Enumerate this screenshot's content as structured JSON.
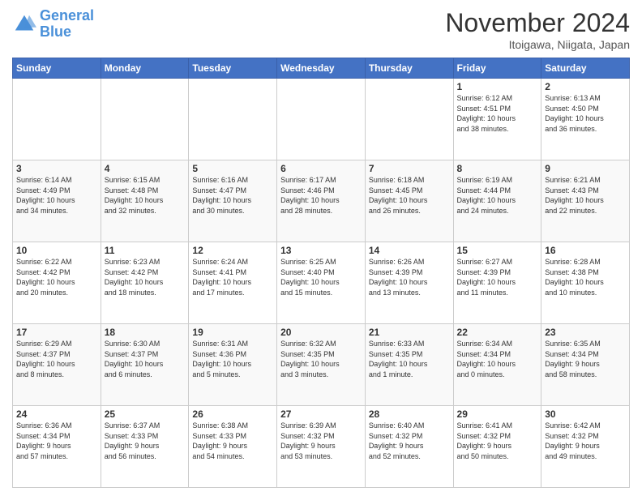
{
  "header": {
    "logo_line1": "General",
    "logo_line2": "Blue",
    "month": "November 2024",
    "location": "Itoigawa, Niigata, Japan"
  },
  "weekdays": [
    "Sunday",
    "Monday",
    "Tuesday",
    "Wednesday",
    "Thursday",
    "Friday",
    "Saturday"
  ],
  "weeks": [
    [
      {
        "day": "",
        "info": ""
      },
      {
        "day": "",
        "info": ""
      },
      {
        "day": "",
        "info": ""
      },
      {
        "day": "",
        "info": ""
      },
      {
        "day": "",
        "info": ""
      },
      {
        "day": "1",
        "info": "Sunrise: 6:12 AM\nSunset: 4:51 PM\nDaylight: 10 hours\nand 38 minutes."
      },
      {
        "day": "2",
        "info": "Sunrise: 6:13 AM\nSunset: 4:50 PM\nDaylight: 10 hours\nand 36 minutes."
      }
    ],
    [
      {
        "day": "3",
        "info": "Sunrise: 6:14 AM\nSunset: 4:49 PM\nDaylight: 10 hours\nand 34 minutes."
      },
      {
        "day": "4",
        "info": "Sunrise: 6:15 AM\nSunset: 4:48 PM\nDaylight: 10 hours\nand 32 minutes."
      },
      {
        "day": "5",
        "info": "Sunrise: 6:16 AM\nSunset: 4:47 PM\nDaylight: 10 hours\nand 30 minutes."
      },
      {
        "day": "6",
        "info": "Sunrise: 6:17 AM\nSunset: 4:46 PM\nDaylight: 10 hours\nand 28 minutes."
      },
      {
        "day": "7",
        "info": "Sunrise: 6:18 AM\nSunset: 4:45 PM\nDaylight: 10 hours\nand 26 minutes."
      },
      {
        "day": "8",
        "info": "Sunrise: 6:19 AM\nSunset: 4:44 PM\nDaylight: 10 hours\nand 24 minutes."
      },
      {
        "day": "9",
        "info": "Sunrise: 6:21 AM\nSunset: 4:43 PM\nDaylight: 10 hours\nand 22 minutes."
      }
    ],
    [
      {
        "day": "10",
        "info": "Sunrise: 6:22 AM\nSunset: 4:42 PM\nDaylight: 10 hours\nand 20 minutes."
      },
      {
        "day": "11",
        "info": "Sunrise: 6:23 AM\nSunset: 4:42 PM\nDaylight: 10 hours\nand 18 minutes."
      },
      {
        "day": "12",
        "info": "Sunrise: 6:24 AM\nSunset: 4:41 PM\nDaylight: 10 hours\nand 17 minutes."
      },
      {
        "day": "13",
        "info": "Sunrise: 6:25 AM\nSunset: 4:40 PM\nDaylight: 10 hours\nand 15 minutes."
      },
      {
        "day": "14",
        "info": "Sunrise: 6:26 AM\nSunset: 4:39 PM\nDaylight: 10 hours\nand 13 minutes."
      },
      {
        "day": "15",
        "info": "Sunrise: 6:27 AM\nSunset: 4:39 PM\nDaylight: 10 hours\nand 11 minutes."
      },
      {
        "day": "16",
        "info": "Sunrise: 6:28 AM\nSunset: 4:38 PM\nDaylight: 10 hours\nand 10 minutes."
      }
    ],
    [
      {
        "day": "17",
        "info": "Sunrise: 6:29 AM\nSunset: 4:37 PM\nDaylight: 10 hours\nand 8 minutes."
      },
      {
        "day": "18",
        "info": "Sunrise: 6:30 AM\nSunset: 4:37 PM\nDaylight: 10 hours\nand 6 minutes."
      },
      {
        "day": "19",
        "info": "Sunrise: 6:31 AM\nSunset: 4:36 PM\nDaylight: 10 hours\nand 5 minutes."
      },
      {
        "day": "20",
        "info": "Sunrise: 6:32 AM\nSunset: 4:35 PM\nDaylight: 10 hours\nand 3 minutes."
      },
      {
        "day": "21",
        "info": "Sunrise: 6:33 AM\nSunset: 4:35 PM\nDaylight: 10 hours\nand 1 minute."
      },
      {
        "day": "22",
        "info": "Sunrise: 6:34 AM\nSunset: 4:34 PM\nDaylight: 10 hours\nand 0 minutes."
      },
      {
        "day": "23",
        "info": "Sunrise: 6:35 AM\nSunset: 4:34 PM\nDaylight: 9 hours\nand 58 minutes."
      }
    ],
    [
      {
        "day": "24",
        "info": "Sunrise: 6:36 AM\nSunset: 4:34 PM\nDaylight: 9 hours\nand 57 minutes."
      },
      {
        "day": "25",
        "info": "Sunrise: 6:37 AM\nSunset: 4:33 PM\nDaylight: 9 hours\nand 56 minutes."
      },
      {
        "day": "26",
        "info": "Sunrise: 6:38 AM\nSunset: 4:33 PM\nDaylight: 9 hours\nand 54 minutes."
      },
      {
        "day": "27",
        "info": "Sunrise: 6:39 AM\nSunset: 4:32 PM\nDaylight: 9 hours\nand 53 minutes."
      },
      {
        "day": "28",
        "info": "Sunrise: 6:40 AM\nSunset: 4:32 PM\nDaylight: 9 hours\nand 52 minutes."
      },
      {
        "day": "29",
        "info": "Sunrise: 6:41 AM\nSunset: 4:32 PM\nDaylight: 9 hours\nand 50 minutes."
      },
      {
        "day": "30",
        "info": "Sunrise: 6:42 AM\nSunset: 4:32 PM\nDaylight: 9 hours\nand 49 minutes."
      }
    ]
  ]
}
